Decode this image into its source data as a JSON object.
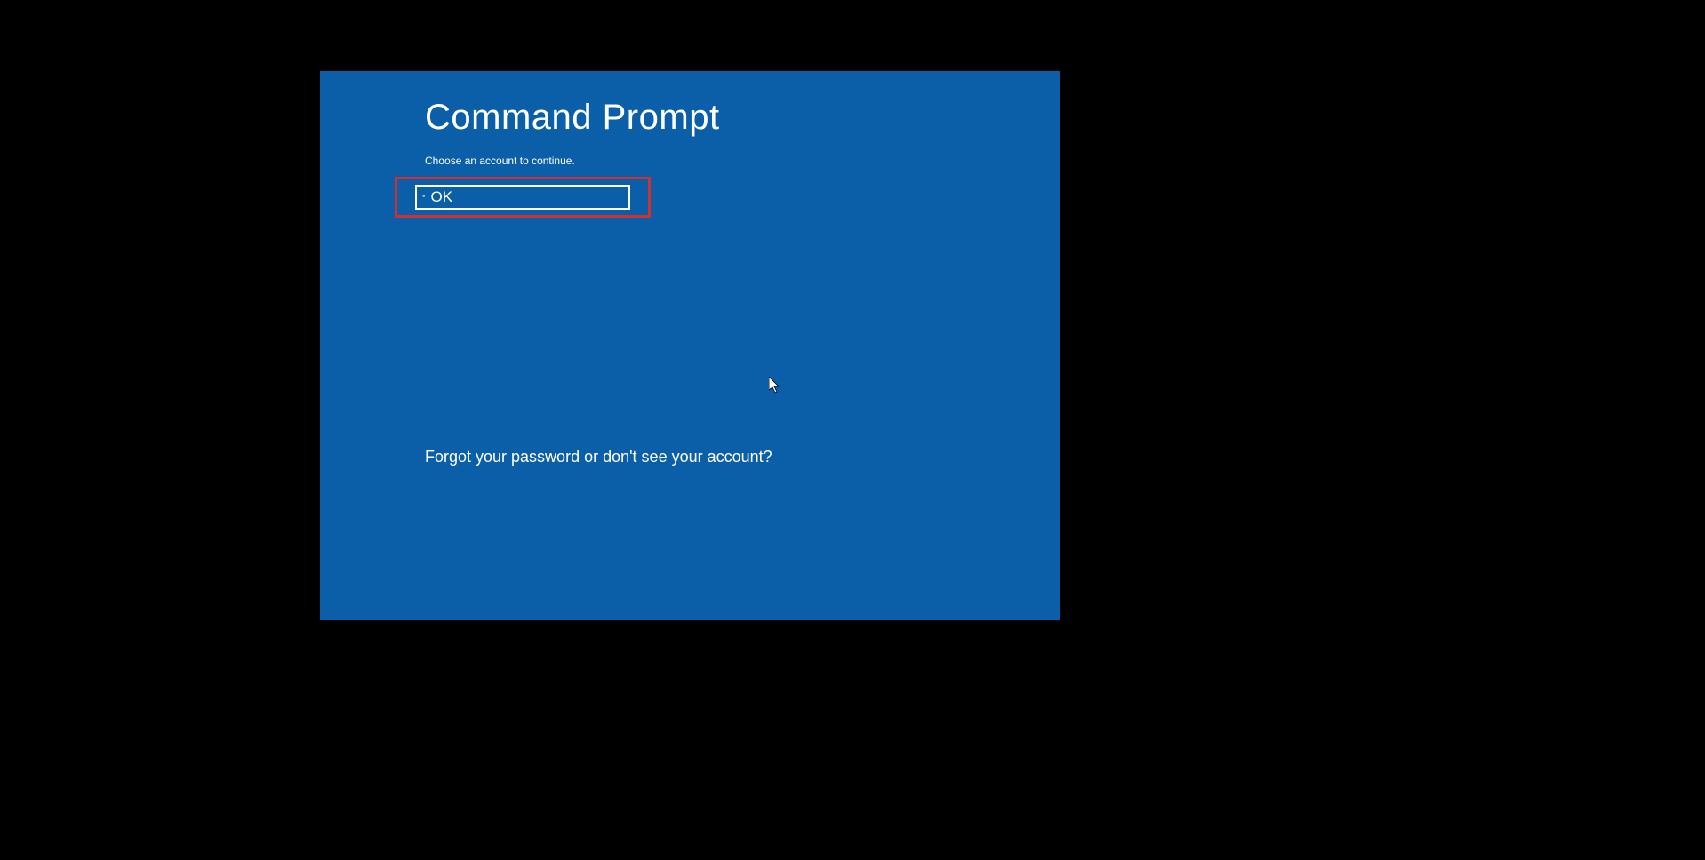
{
  "title": "Command Prompt",
  "subtitle": "Choose an account to continue.",
  "account": {
    "label": "OK"
  },
  "forgot_text": "Forgot your password or don't see your account?"
}
